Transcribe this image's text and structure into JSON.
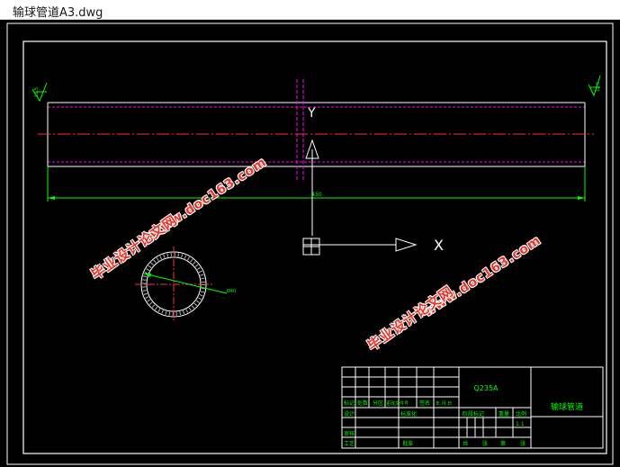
{
  "window": {
    "title": "输球管道A3.dwg"
  },
  "drawing": {
    "dimension_length": "450",
    "dimension_diameter": "Ø40",
    "roughness_left": "12.5",
    "roughness_right": "12.5",
    "watermark_url": "www.doc163.com",
    "watermark_cn": "毕业设计论文网"
  },
  "title_block": {
    "material": "Q235A",
    "part_name": "输球管道",
    "scale_label": "比例",
    "scale_value": "1:1",
    "stage_mark_label": "阶段标记",
    "weight_label": "重量",
    "row_labels": [
      "标记",
      "处数",
      "分区",
      "更改文件号",
      "签名",
      "年.月.日"
    ],
    "design_label": "设计",
    "standardize_label": "标准化",
    "check_label": "审核",
    "process_label": "工艺",
    "approve_label": "批准",
    "sheet_labels": [
      "共",
      "张",
      "第",
      "张"
    ]
  },
  "colors": {
    "outline": "#ffffff",
    "pipe_hidden": "#ff00ff",
    "centerline": "#ff3030",
    "dimension": "#00ff00",
    "watermark": "#e8362a"
  }
}
